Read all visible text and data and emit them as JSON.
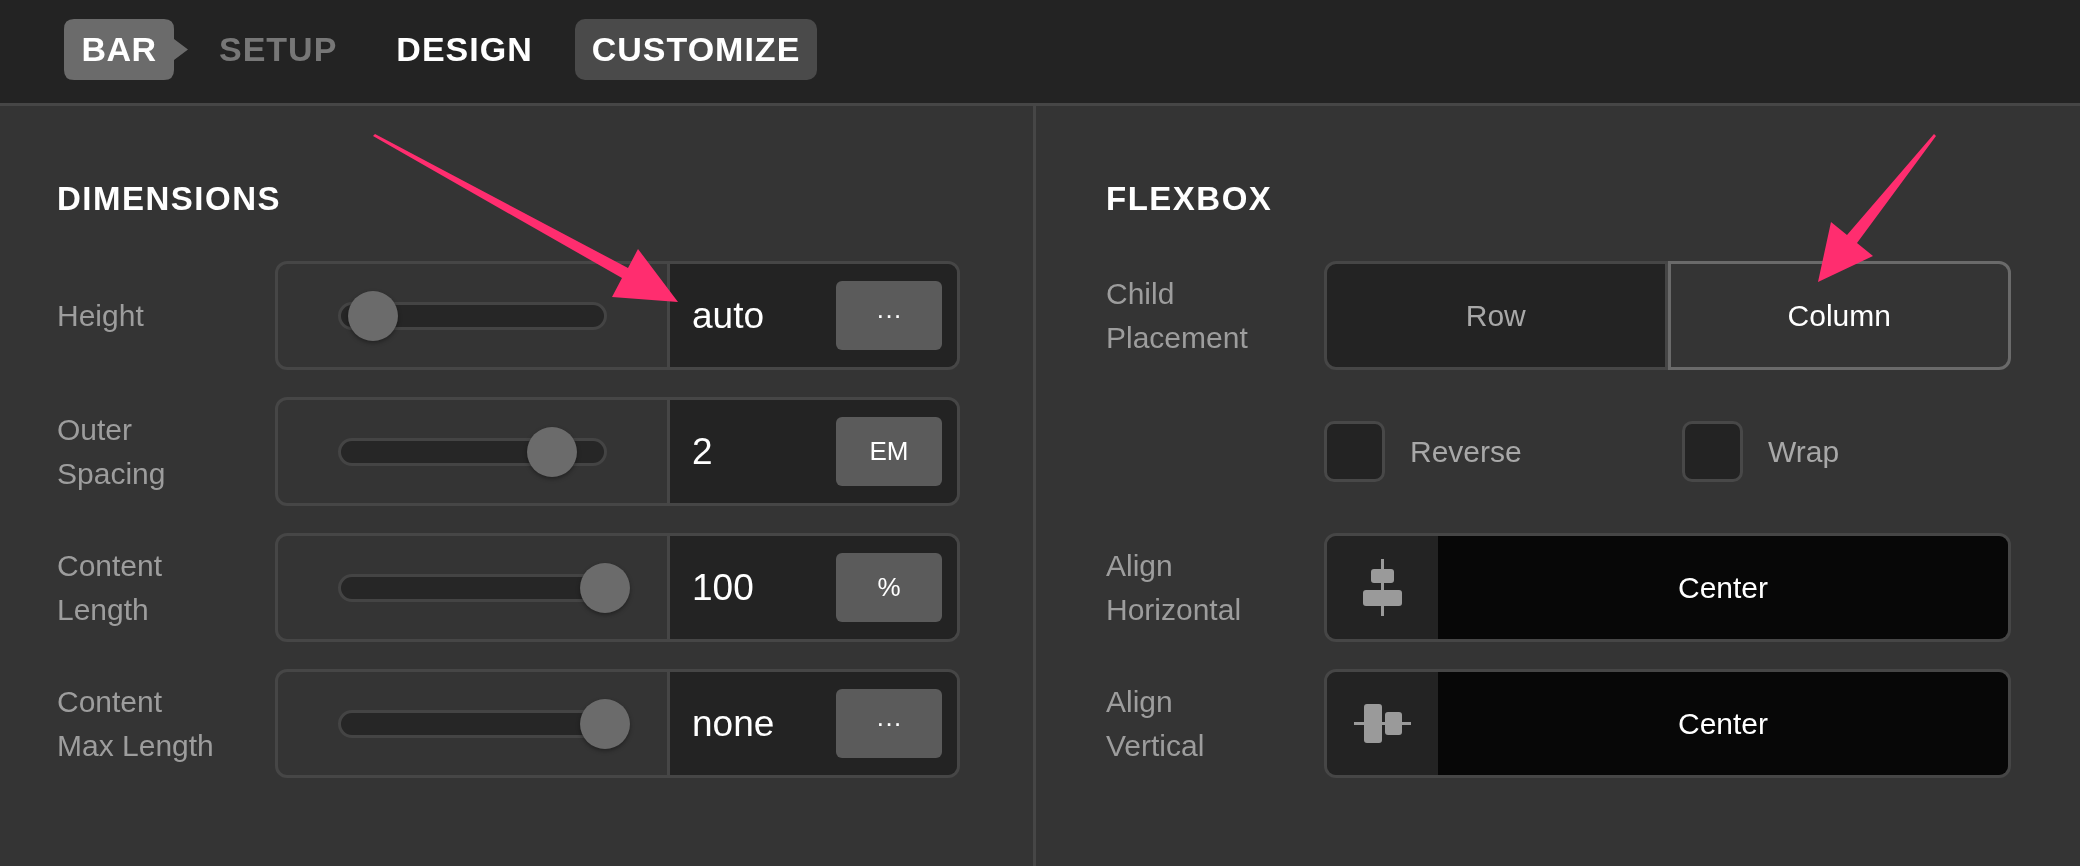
{
  "breadcrumb": {
    "label": "BAR"
  },
  "tabs": [
    {
      "label": "SETUP",
      "selected": false,
      "disabled": true
    },
    {
      "label": "DESIGN",
      "selected": false,
      "disabled": false
    },
    {
      "label": "CUSTOMIZE",
      "selected": true,
      "disabled": false
    }
  ],
  "dimensions": {
    "title": "DIMENSIONS",
    "rows": [
      {
        "label": "Height",
        "level": 0,
        "value": "auto",
        "unit": "···"
      },
      {
        "label": "Outer Spacing",
        "level": 0.77,
        "value": "2",
        "unit": "EM"
      },
      {
        "label": "Content Length",
        "level": 1,
        "value": "100",
        "unit": "%"
      },
      {
        "label": "Content Max Length",
        "level": 1,
        "value": "none",
        "unit": "···"
      }
    ]
  },
  "flexbox": {
    "title": "FLEXBOX",
    "child_placement": {
      "label": "Child Placement",
      "options": [
        {
          "label": "Row",
          "selected": false
        },
        {
          "label": "Column",
          "selected": true
        }
      ]
    },
    "options": [
      {
        "label": "Reverse",
        "checked": false
      },
      {
        "label": "Wrap",
        "checked": false
      }
    ],
    "alignment": [
      {
        "label": "Align Horizontal",
        "kind": "horizontal",
        "value": "Center"
      },
      {
        "label": "Align Vertical",
        "kind": "vertical",
        "value": "Center"
      }
    ]
  }
}
